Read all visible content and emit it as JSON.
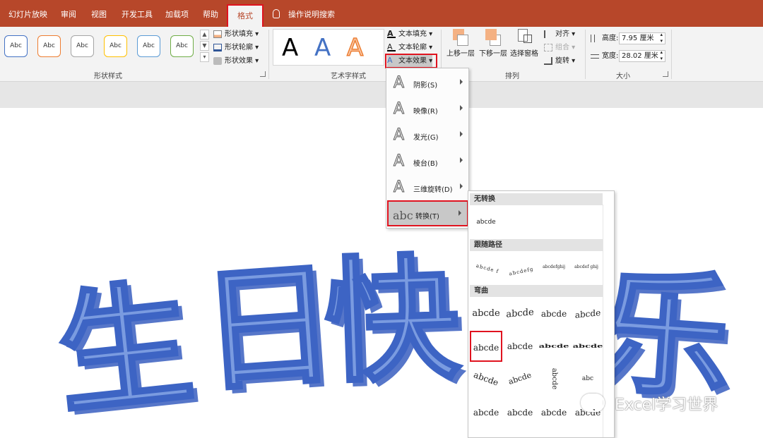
{
  "tabs": [
    {
      "label": "幻灯片放映"
    },
    {
      "label": "审阅"
    },
    {
      "label": "视图"
    },
    {
      "label": "开发工具"
    },
    {
      "label": "加载项"
    },
    {
      "label": "帮助"
    },
    {
      "label": "格式"
    }
  ],
  "tellme": {
    "label": "操作说明搜索",
    "icon": "lightbulb-icon"
  },
  "shape_styles": {
    "swatch_label": "Abc",
    "swatch_colors": [
      "#4472c4",
      "#ed7d31",
      "#a5a5a5",
      "#ffc000",
      "#5b9bd5",
      "#70ad47"
    ],
    "fill": "形状填充",
    "outline": "形状轮廓",
    "effects": "形状效果",
    "group_label": "形状样式"
  },
  "wordart_styles": {
    "samples": [
      {
        "letter": "A",
        "color": "#000000"
      },
      {
        "letter": "A",
        "color": "#4472c4"
      },
      {
        "letter": "A",
        "color": "#ed7d31"
      }
    ],
    "text_fill": "文本填充",
    "text_outline": "文本轮廓",
    "text_effects": "文本效果",
    "group_label": "艺术字样式"
  },
  "arrange": {
    "bring_forward": "上移一层",
    "send_backward": "下移一层",
    "selection_pane": "选择窗格",
    "align": "对齐",
    "group": "组合",
    "rotate": "旋转",
    "group_label": "排列"
  },
  "size": {
    "height_label": "高度:",
    "height_value": "7.95 厘米",
    "width_label": "宽度:",
    "width_value": "28.02 厘米",
    "group_label": "大小"
  },
  "canvas_text": [
    "生",
    "日",
    "快",
    "乐"
  ],
  "effects_menu": [
    {
      "label": "阴影(S)"
    },
    {
      "label": "映像(R)"
    },
    {
      "label": "发光(G)"
    },
    {
      "label": "棱台(B)"
    },
    {
      "label": "三维旋转(D)"
    },
    {
      "label": "转换(T)"
    }
  ],
  "transform_gallery": {
    "no_transform": "无转换",
    "no_transform_sample": "abcde",
    "follow_path": "跟随路径",
    "follow_path_samples": [
      "abcde f",
      "abcdefg",
      "abcdefghij",
      "abcdef ghij"
    ],
    "warp": "弯曲",
    "warp_samples": [
      "abcde",
      "abcde",
      "abcde",
      "abcde",
      "abcde",
      "abcde",
      "abcde",
      "abcde",
      "abcde",
      "abcde",
      "abcde",
      "abc",
      "abcde",
      "abcde",
      "abcde",
      "abcde"
    ]
  },
  "watermark": "Excel学习世界",
  "colors": {
    "accent": "#b7472a",
    "highlight_box": "#e0131f",
    "wordart_fill": "#7a9be0",
    "wordart_outline": "#3d64c4"
  }
}
